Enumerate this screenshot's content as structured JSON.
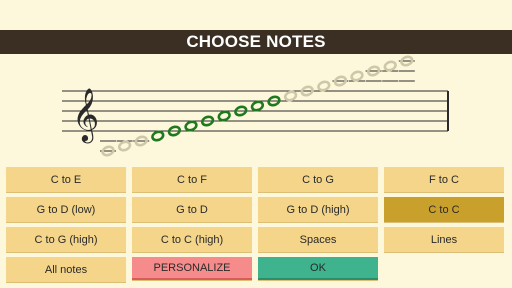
{
  "header": {
    "title": "CHOOSE NOTES"
  },
  "staff": {
    "clef": "treble-clef-icon",
    "notes": [
      {
        "index": 0,
        "selected": false
      },
      {
        "index": 1,
        "selected": false
      },
      {
        "index": 2,
        "selected": false
      },
      {
        "index": 3,
        "selected": true
      },
      {
        "index": 4,
        "selected": true
      },
      {
        "index": 5,
        "selected": true
      },
      {
        "index": 6,
        "selected": true
      },
      {
        "index": 7,
        "selected": true
      },
      {
        "index": 8,
        "selected": true
      },
      {
        "index": 9,
        "selected": true
      },
      {
        "index": 10,
        "selected": true
      },
      {
        "index": 11,
        "selected": false
      },
      {
        "index": 12,
        "selected": false
      },
      {
        "index": 13,
        "selected": false
      },
      {
        "index": 14,
        "selected": false
      },
      {
        "index": 15,
        "selected": false
      },
      {
        "index": 16,
        "selected": false
      },
      {
        "index": 17,
        "selected": false
      },
      {
        "index": 18,
        "selected": false
      }
    ],
    "colors": {
      "selected": "#1f7a1f",
      "unselected": "#cfc8a8"
    }
  },
  "buttons": [
    {
      "label": "C to E",
      "selected": false
    },
    {
      "label": "C to F",
      "selected": false
    },
    {
      "label": "C to G",
      "selected": false
    },
    {
      "label": "F to C",
      "selected": false
    },
    {
      "label": "G to D (low)",
      "selected": false
    },
    {
      "label": "G to D",
      "selected": false
    },
    {
      "label": "G to D (high)",
      "selected": false
    },
    {
      "label": "C to C",
      "selected": true
    },
    {
      "label": "C to G (high)",
      "selected": false
    },
    {
      "label": "C to C (high)",
      "selected": false
    },
    {
      "label": "Spaces",
      "selected": false
    },
    {
      "label": "Lines",
      "selected": false
    },
    {
      "label": "All notes",
      "selected": false
    }
  ],
  "actions": {
    "personalize": "PERSONALIZE",
    "ok": "OK"
  }
}
